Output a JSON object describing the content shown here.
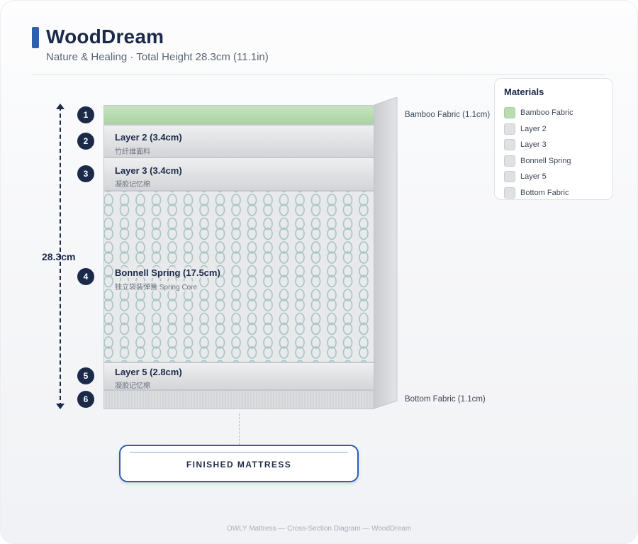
{
  "header": {
    "title": "WoodDream",
    "subtitle": "Nature & Healing · Total Height 28.3cm (11.1in)"
  },
  "dimension": {
    "label": "28.3cm"
  },
  "layers": [
    {
      "number": "1",
      "title": "",
      "subtitle": "",
      "color": "#a9d3a1"
    },
    {
      "number": "2",
      "title": "Layer 2 (3.4cm)",
      "subtitle": "竹纤维面料",
      "color": "#d6d7d9"
    },
    {
      "number": "3",
      "title": "Layer 3 (3.4cm)",
      "subtitle": "凝胶记忆棉",
      "color": "#d6d7d9"
    },
    {
      "number": "4",
      "title": "Bonnell Spring (17.5cm)",
      "subtitle": "独立袋装弹簧 Spring Core",
      "color": "#e9eaec"
    },
    {
      "number": "5",
      "title": "Layer 5 (2.8cm)",
      "subtitle": "凝胶记忆棉",
      "color": "#d6d7d9"
    },
    {
      "number": "6",
      "title": "",
      "subtitle": "",
      "color": "#dcdddf"
    }
  ],
  "side_labels": {
    "top": "Bamboo Fabric (1.1cm)",
    "bottom": "Bottom Fabric (1.1cm)"
  },
  "legend": {
    "title": "Materials",
    "items": [
      {
        "label": "Bamboo Fabric",
        "color": "#b9dcb3"
      },
      {
        "label": "Layer 2",
        "color": "#e0e1e3"
      },
      {
        "label": "Layer 3",
        "color": "#e0e1e3"
      },
      {
        "label": "Bonnell Spring",
        "color": "#e0e1e3"
      },
      {
        "label": "Layer 5",
        "color": "#e0e1e3"
      },
      {
        "label": "Bottom Fabric",
        "color": "#e0e1e3"
      }
    ]
  },
  "finished": {
    "label": "FINISHED MATTRESS"
  },
  "footer": {
    "text": "OWLY Mattress — Cross-Section Diagram — WoodDream"
  },
  "colors": {
    "accent": "#2c5fb2",
    "navy": "#1c2a4a",
    "spring": "#a9c4c4"
  }
}
